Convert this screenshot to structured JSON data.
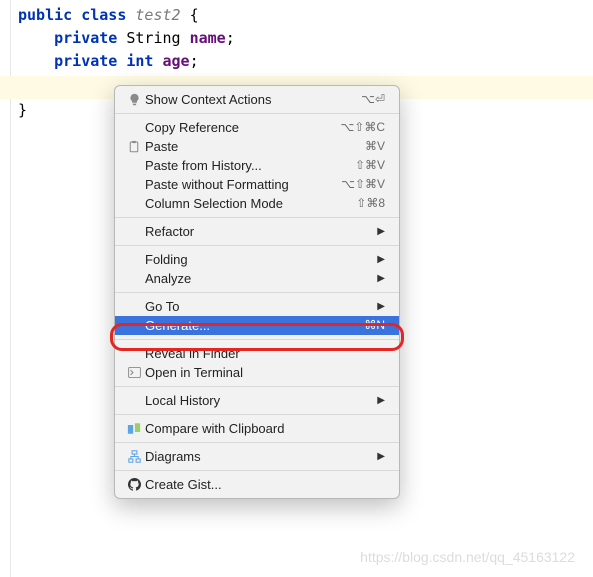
{
  "code": {
    "line1_kw1": "public",
    "line1_kw2": "class",
    "line1_name": "test2",
    "line1_brace": " {",
    "line2_kw": "private",
    "line2_type": "String",
    "line2_field": "name",
    "line2_semi": ";",
    "line3_kw": "private",
    "line3_type": "int",
    "line3_field": "age",
    "line3_semi": ";",
    "line5_brace": "}"
  },
  "menu": {
    "show_context_actions": {
      "label": "Show Context Actions",
      "shortcut": "⌥⏎"
    },
    "copy_reference": {
      "label": "Copy Reference",
      "shortcut": "⌥⇧⌘C"
    },
    "paste": {
      "label": "Paste",
      "shortcut": "⌘V"
    },
    "paste_history": {
      "label": "Paste from History...",
      "shortcut": "⇧⌘V"
    },
    "paste_no_format": {
      "label": "Paste without Formatting",
      "shortcut": "⌥⇧⌘V"
    },
    "column_selection": {
      "label": "Column Selection Mode",
      "shortcut": "⇧⌘8"
    },
    "refactor": {
      "label": "Refactor"
    },
    "folding": {
      "label": "Folding"
    },
    "analyze": {
      "label": "Analyze"
    },
    "go_to": {
      "label": "Go To"
    },
    "generate": {
      "label": "Generate...",
      "shortcut": "⌘N"
    },
    "reveal_finder": {
      "label": "Reveal in Finder"
    },
    "open_terminal": {
      "label": "Open in Terminal"
    },
    "local_history": {
      "label": "Local History"
    },
    "compare_clipboard": {
      "label": "Compare with Clipboard"
    },
    "diagrams": {
      "label": "Diagrams"
    },
    "create_gist": {
      "label": "Create Gist..."
    }
  },
  "watermark": "https://blog.csdn.net/qq_45163122"
}
